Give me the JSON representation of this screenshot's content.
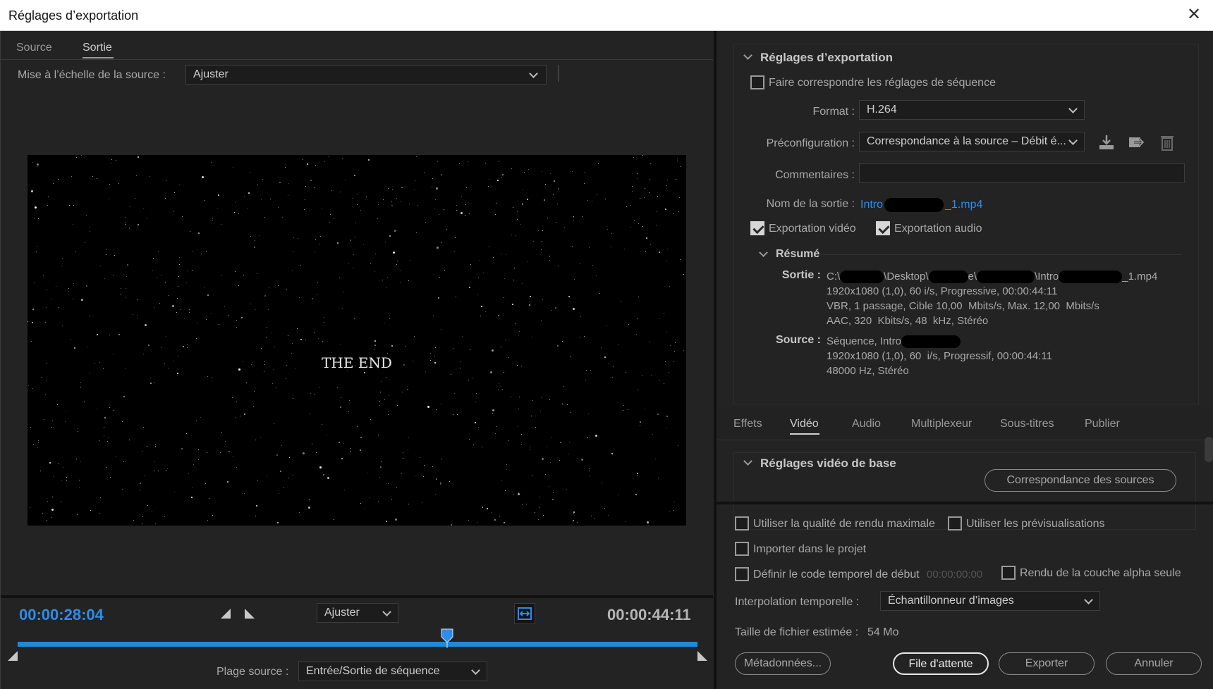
{
  "window": {
    "title": "Réglages d’exportation",
    "close_glyph": "✕"
  },
  "left": {
    "tabs": [
      {
        "label": "Source"
      },
      {
        "label": "Sortie"
      }
    ],
    "scale_label": "Mise à l’échelle de la source :",
    "scale_value": "Ajuster",
    "video_text": "THE END",
    "timecode_current": "00:00:28:04",
    "timecode_end": "00:00:44:11",
    "zoom_value": "Ajuster",
    "range_label": "Plage source :",
    "range_value": "Entrée/Sortie de séquence",
    "playhead_fraction": 0.6315
  },
  "right": {
    "export_settings": {
      "title": "Réglages d’exportation",
      "match_sequence_label": "Faire correspondre les réglages de séquence",
      "format_label": "Format :",
      "format_value": "H.264",
      "preset_label": "Préconfiguration :",
      "preset_value": "Correspondance à la source – Débit é...",
      "comments_label": "Commentaires :",
      "comments_value": "",
      "output_name_label": "Nom de la sortie :",
      "output_name_prefix": "Intro",
      "output_name_suffix": "_1.mp4",
      "export_video_label": "Exportation vidéo",
      "export_audio_label": "Exportation audio"
    },
    "summary": {
      "title": "Résumé",
      "output_label": "Sortie :",
      "output_lines": [
        "1920x1080 (1,0), 60 i/s, Progressive, 00:00:44:11",
        "VBR, 1 passage, Cible 10,00  Mbits/s, Max. 12,00  Mbits/s",
        "AAC, 320  Kbits/s, 48  kHz, Stéréo"
      ],
      "output_path_parts": [
        "C:\\",
        "\\Desktop\\",
        "e\\",
        "\\Intro",
        "_1.mp4"
      ],
      "source_label": "Source :",
      "source_first": "Séquence, Intro",
      "source_lines": [
        "1920x1080 (1,0), 60  i/s, Progressif, 00:00:44:11",
        "48000 Hz, Stéréo"
      ]
    },
    "tabs": [
      {
        "label": "Effets"
      },
      {
        "label": "Vidéo"
      },
      {
        "label": "Audio"
      },
      {
        "label": "Multiplexeur"
      },
      {
        "label": "Sous-titres"
      },
      {
        "label": "Publier"
      }
    ],
    "basic_video": {
      "title": "Réglages vidéo de base",
      "match_button": "Correspondance des sources"
    },
    "bottom": {
      "max_quality_label": "Utiliser la qualité de rendu maximale",
      "use_previews_label": "Utiliser les prévisualisations",
      "import_label": "Importer dans le projet",
      "start_tc_label": "Définir le code temporel de début",
      "start_tc_value": "00:00:00:00",
      "alpha_label": "Rendu de la couche alpha seule",
      "interp_label": "Interpolation temporelle :",
      "interp_value": "Échantillonneur d’images",
      "filesize_label": "Taille de fichier estimée :",
      "filesize_value": "54 Mo",
      "metadata_button": "Métadonnées...",
      "queue_button": "File d'attente",
      "export_button": "Exporter",
      "cancel_button": "Annuler"
    }
  }
}
